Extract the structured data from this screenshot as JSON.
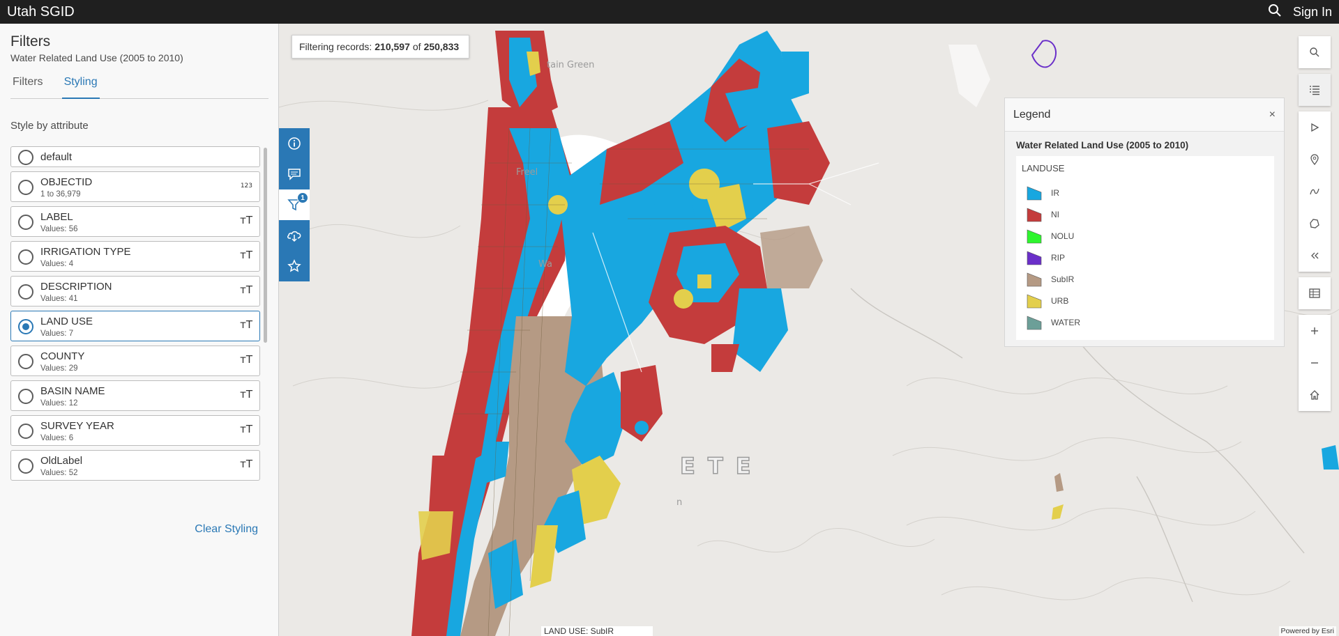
{
  "app": {
    "title": "Utah SGID",
    "sign_in": "Sign In"
  },
  "panel": {
    "title": "Filters",
    "subtitle": "Water Related Land Use (2005 to 2010)",
    "tabs": [
      {
        "label": "Filters",
        "active": false
      },
      {
        "label": "Styling",
        "active": true
      }
    ],
    "section_label": "Style by attribute",
    "attributes": [
      {
        "name": "default",
        "sub": "",
        "type": "",
        "selected": false
      },
      {
        "name": "OBJECTID",
        "sub": "1 to 36,979",
        "type": "123",
        "selected": false
      },
      {
        "name": "LABEL",
        "sub": "Values: 56",
        "type": "тT",
        "selected": false
      },
      {
        "name": "IRRIGATION TYPE",
        "sub": "Values: 4",
        "type": "тT",
        "selected": false
      },
      {
        "name": "DESCRIPTION",
        "sub": "Values: 41",
        "type": "тT",
        "selected": false
      },
      {
        "name": "LAND USE",
        "sub": "Values: 7",
        "type": "тT",
        "selected": true
      },
      {
        "name": "COUNTY",
        "sub": "Values: 29",
        "type": "тT",
        "selected": false
      },
      {
        "name": "BASIN NAME",
        "sub": "Values: 12",
        "type": "тT",
        "selected": false
      },
      {
        "name": "SURVEY YEAR",
        "sub": "Values: 6",
        "type": "тT",
        "selected": false
      },
      {
        "name": "OldLabel",
        "sub": "Values: 52",
        "type": "тT",
        "selected": false
      }
    ],
    "clear_styling": "Clear Styling"
  },
  "map": {
    "filter_prefix": "Filtering records:",
    "filter_count": "210,597",
    "filter_of": "of",
    "filter_total": "250,833",
    "filter_badge": "1",
    "places": [
      "tain Green",
      "Freel",
      "Wa",
      "n"
    ],
    "big_label": "ETE",
    "popup_label": "LAND USE: SubIR",
    "powered_by": "Powered by Esri"
  },
  "legend": {
    "title": "Legend",
    "close": "×",
    "layer": "Water Related Land Use (2005 to 2010)",
    "field": "LANDUSE",
    "items": [
      {
        "label": "IR",
        "color": "#18a7e0"
      },
      {
        "label": "NI",
        "color": "#c43c3c"
      },
      {
        "label": "NOLU",
        "color": "#2ef52e"
      },
      {
        "label": "RIP",
        "color": "#6a2fc9"
      },
      {
        "label": "SubIR",
        "color": "#b59a84"
      },
      {
        "label": "URB",
        "color": "#e3cf4c"
      },
      {
        "label": "WATER",
        "color": "#6c9f98"
      }
    ]
  },
  "icons": {
    "topbar": [
      "search-icon"
    ],
    "side_tools": [
      "info-icon",
      "comment-icon",
      "filter-icon",
      "download-icon",
      "star-icon"
    ],
    "right_tools": [
      "search-icon",
      "legend-list-icon",
      "select-arrow-icon",
      "measure-pin-icon",
      "draw-line-icon",
      "shape-icon",
      "collapse-icon",
      "table-icon",
      "zoom-in-icon",
      "zoom-out-icon",
      "home-icon"
    ]
  }
}
